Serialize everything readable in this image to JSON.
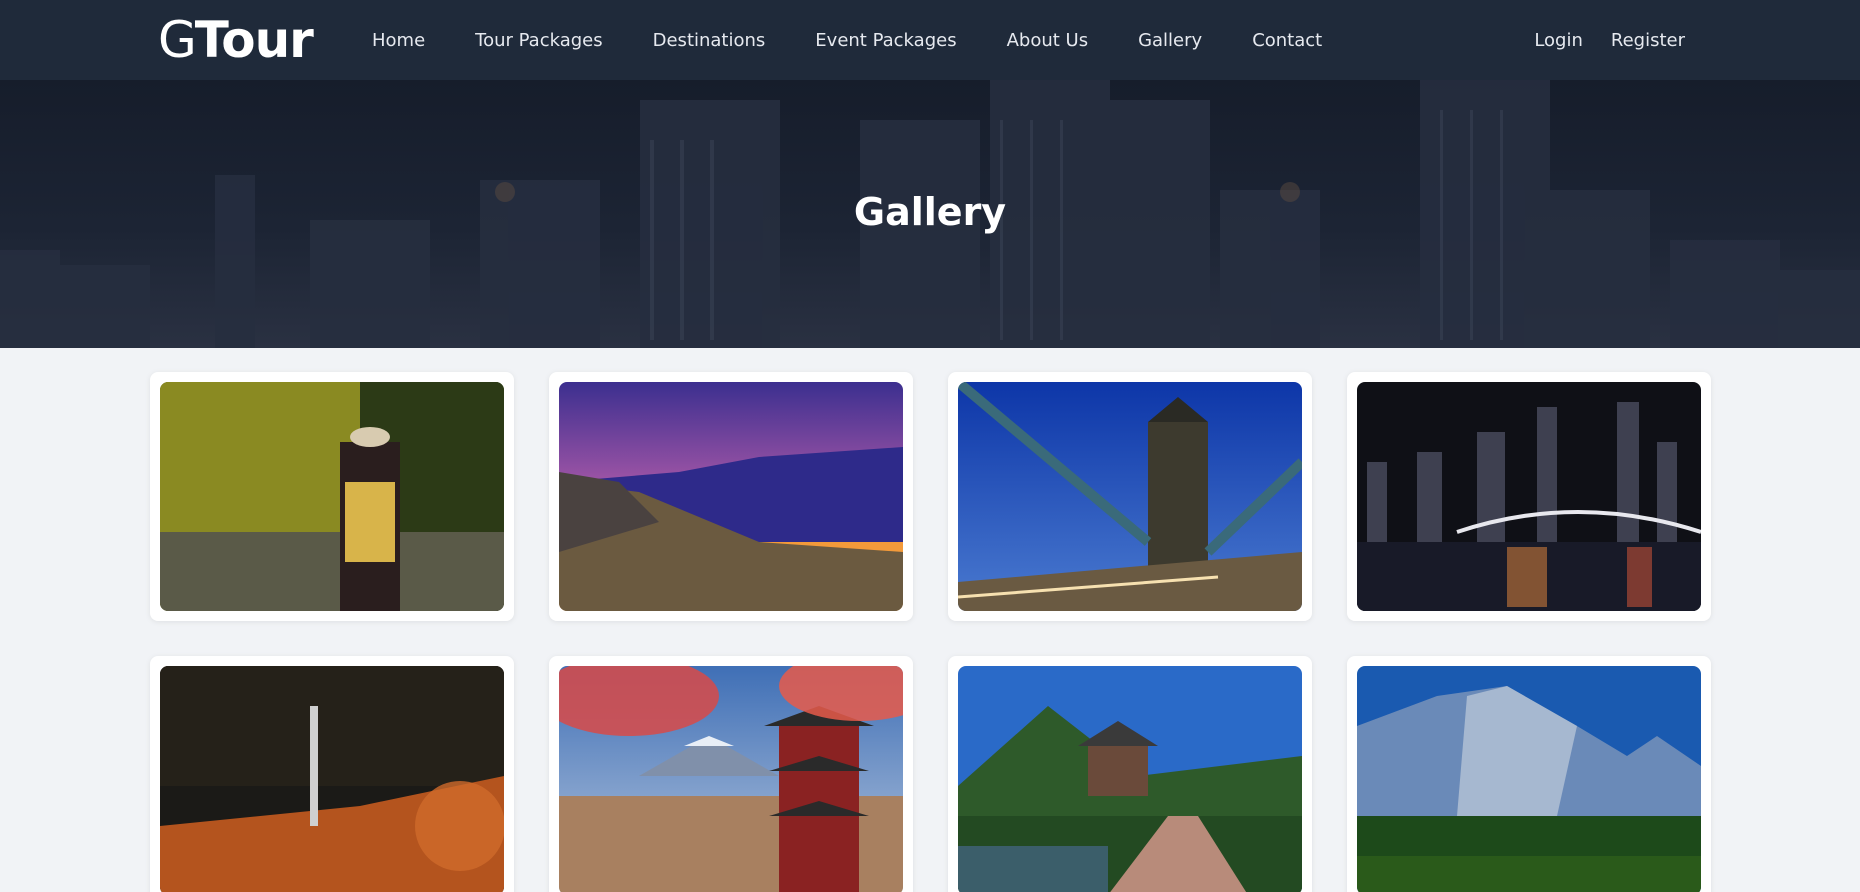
{
  "brand": {
    "logo_g": "G",
    "logo_rest": "Tour"
  },
  "nav": {
    "items": [
      {
        "label": "Home"
      },
      {
        "label": "Tour Packages"
      },
      {
        "label": "Destinations"
      },
      {
        "label": "Event Packages"
      },
      {
        "label": "About Us"
      },
      {
        "label": "Gallery"
      },
      {
        "label": "Contact"
      }
    ],
    "login_label": "Login",
    "register_label": "Register"
  },
  "hero": {
    "title": "Gallery"
  },
  "gallery": {
    "photos": [
      {
        "subject": "hiker-forest-photo"
      },
      {
        "subject": "mountain-sunset-photo"
      },
      {
        "subject": "tower-bridge-photo"
      },
      {
        "subject": "city-skyline-night-photo"
      },
      {
        "subject": "autumn-waterfall-photo"
      },
      {
        "subject": "pagoda-mount-fuji-photo"
      },
      {
        "subject": "korean-pavilion-photo"
      },
      {
        "subject": "yosemite-cliff-photo"
      }
    ]
  },
  "colors": {
    "navbar_bg": "#1f2a3a",
    "page_bg": "#f1f3f6",
    "hero_overlay": "#1a2130",
    "text_light": "#ffffff"
  }
}
